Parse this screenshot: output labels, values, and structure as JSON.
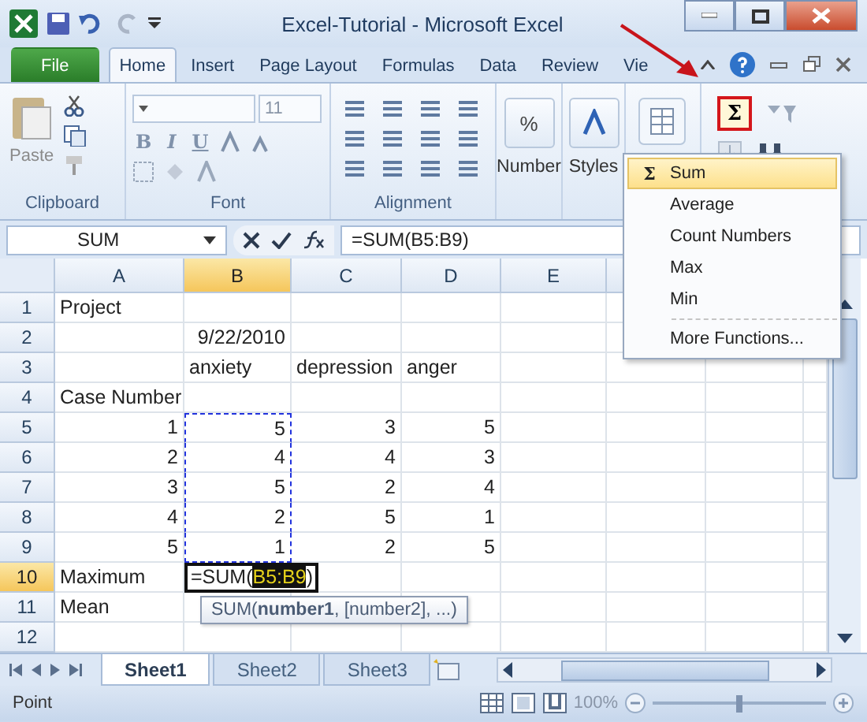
{
  "window": {
    "title": "Excel-Tutorial  -  Microsoft Excel"
  },
  "tabs": [
    {
      "label": "File",
      "kind": "file",
      "selected": false
    },
    {
      "label": "Home",
      "kind": "tab",
      "selected": true
    },
    {
      "label": "Insert",
      "kind": "tab",
      "selected": false
    },
    {
      "label": "Page Layout",
      "kind": "tab",
      "selected": false
    },
    {
      "label": "Formulas",
      "kind": "tab",
      "selected": false
    },
    {
      "label": "Data",
      "kind": "tab",
      "selected": false
    },
    {
      "label": "Review",
      "kind": "tab",
      "selected": false
    },
    {
      "label": "Vie",
      "kind": "tab",
      "selected": false
    }
  ],
  "ribbon": {
    "clipboard": {
      "label": "Clipboard",
      "paste": "Paste"
    },
    "font": {
      "label": "Font",
      "size": "11",
      "styles": [
        "B",
        "I",
        "U"
      ]
    },
    "alignment": {
      "label": "Alignment"
    },
    "number": {
      "symbol": "%",
      "label": "Number"
    },
    "styles": {
      "label": "Styles"
    },
    "editing": {
      "autosum": "Σ"
    }
  },
  "formula_bar": {
    "name_box": "SUM",
    "formula": "=SUM(B5:B9)"
  },
  "sheet": {
    "columns": [
      {
        "label": "A",
        "selected": false
      },
      {
        "label": "B",
        "selected": true
      },
      {
        "label": "C",
        "selected": false
      },
      {
        "label": "D",
        "selected": false
      },
      {
        "label": "E",
        "selected": false
      }
    ],
    "rows": [
      {
        "label": "1",
        "selected": false,
        "cells": [
          {
            "text": "Project",
            "kind": "text",
            "marked": false
          },
          null,
          null,
          null
        ]
      },
      {
        "label": "2",
        "selected": false,
        "cells": [
          null,
          {
            "text": "9/22/2010",
            "kind": "number",
            "marked": false
          },
          null,
          null
        ]
      },
      {
        "label": "3",
        "selected": false,
        "cells": [
          null,
          {
            "text": "anxiety",
            "kind": "text",
            "marked": false
          },
          {
            "text": "depression",
            "kind": "text",
            "marked": false
          },
          {
            "text": "anger",
            "kind": "text",
            "marked": false
          }
        ]
      },
      {
        "label": "4",
        "selected": false,
        "cells": [
          {
            "text": "Case Number",
            "kind": "text",
            "marked": false
          },
          null,
          null,
          null
        ]
      },
      {
        "label": "5",
        "selected": false,
        "cells": [
          {
            "text": "1",
            "kind": "number",
            "marked": false
          },
          {
            "text": "5",
            "kind": "number",
            "marked": true
          },
          {
            "text": "3",
            "kind": "number",
            "marked": false
          },
          {
            "text": "5",
            "kind": "number",
            "marked": false
          }
        ]
      },
      {
        "label": "6",
        "selected": false,
        "cells": [
          {
            "text": "2",
            "kind": "number",
            "marked": false
          },
          {
            "text": "4",
            "kind": "number",
            "marked": true
          },
          {
            "text": "4",
            "kind": "number",
            "marked": false
          },
          {
            "text": "3",
            "kind": "number",
            "marked": false
          }
        ]
      },
      {
        "label": "7",
        "selected": false,
        "cells": [
          {
            "text": "3",
            "kind": "number",
            "marked": false
          },
          {
            "text": "5",
            "kind": "number",
            "marked": true
          },
          {
            "text": "2",
            "kind": "number",
            "marked": false
          },
          {
            "text": "4",
            "kind": "number",
            "marked": false
          }
        ]
      },
      {
        "label": "8",
        "selected": false,
        "cells": [
          {
            "text": "4",
            "kind": "number",
            "marked": false
          },
          {
            "text": "2",
            "kind": "number",
            "marked": true
          },
          {
            "text": "5",
            "kind": "number",
            "marked": false
          },
          {
            "text": "1",
            "kind": "number",
            "marked": false
          }
        ]
      },
      {
        "label": "9",
        "selected": false,
        "cells": [
          {
            "text": "5",
            "kind": "number",
            "marked": false
          },
          {
            "text": "1",
            "kind": "number",
            "marked": true
          },
          {
            "text": "2",
            "kind": "number",
            "marked": false
          },
          {
            "text": "5",
            "kind": "number",
            "marked": false
          }
        ]
      },
      {
        "label": "10",
        "selected": true,
        "cells": [
          {
            "text": "Maximum",
            "kind": "text",
            "marked": false
          },
          {
            "kind": "formula",
            "prefix": "=SUM(",
            "reference": "B5:B9",
            "suffix": ")",
            "marked": false
          },
          null,
          null
        ]
      },
      {
        "label": "11",
        "selected": false,
        "cells": [
          {
            "text": "Mean",
            "kind": "text",
            "marked": false
          },
          null,
          null,
          null
        ]
      },
      {
        "label": "12",
        "selected": false,
        "cells": [
          null,
          null,
          null,
          null
        ]
      }
    ]
  },
  "tooltip": {
    "text": "SUM(**number1**, [number2], ...)"
  },
  "sheet_tabs": [
    {
      "label": "Sheet1",
      "selected": true
    },
    {
      "label": "Sheet2",
      "selected": false
    },
    {
      "label": "Sheet3",
      "selected": false
    }
  ],
  "status_bar": {
    "mode": "Point",
    "zoom": "100%",
    "zoom_slider": {
      "level": 0.5
    }
  },
  "autosum_menu": {
    "items": [
      {
        "icon": "Σ",
        "label": "Sum",
        "selected": true,
        "separator_before": false
      },
      {
        "label": "Average",
        "selected": false,
        "separator_before": false
      },
      {
        "label": "Count Numbers",
        "selected": false,
        "separator_before": false
      },
      {
        "label": "Max",
        "selected": false,
        "separator_before": false
      },
      {
        "label": "Min",
        "selected": false,
        "separator_before": false
      },
      {
        "label": "More Functions...",
        "selected": false,
        "separator_before": true
      }
    ]
  }
}
